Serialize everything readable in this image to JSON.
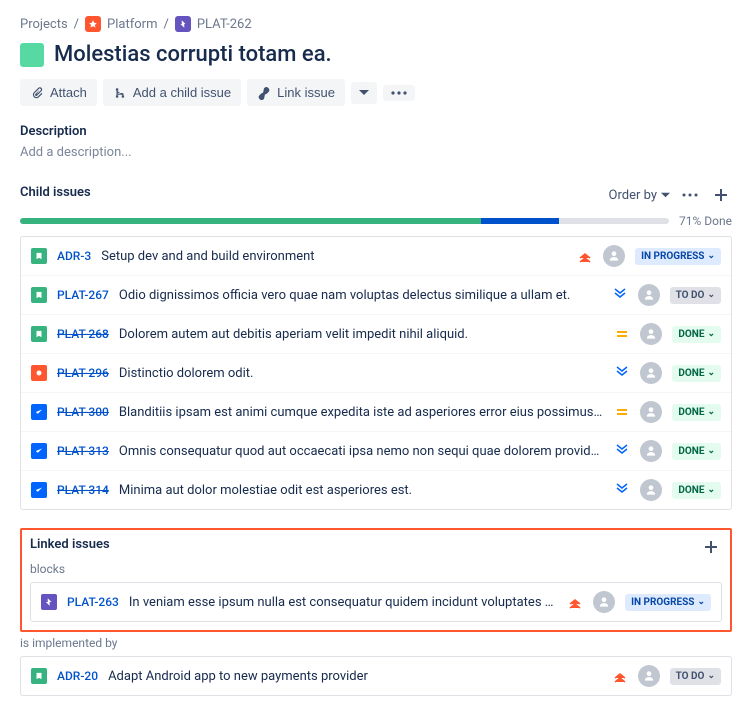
{
  "breadcrumb": {
    "root": "Projects",
    "project": "Platform",
    "issue": "PLAT-262"
  },
  "title": "Molestias corrupti totam ea.",
  "actions": {
    "attach": "Attach",
    "add_child": "Add a child issue",
    "link": "Link issue"
  },
  "description": {
    "label": "Description",
    "placeholder": "Add a description..."
  },
  "child_issues": {
    "label": "Child issues",
    "order_by": "Order by",
    "progress_done_pct": 71,
    "progress_inprogress_pct": 12,
    "progress_label": "71% Done",
    "items": [
      {
        "type": "story",
        "key": "ADR-3",
        "done": false,
        "summary": "Setup dev and and build environment",
        "priority": "highest",
        "status": "IN PROGRESS",
        "status_class": "inprogress"
      },
      {
        "type": "story",
        "key": "PLAT-267",
        "done": false,
        "summary": "Odio dignissimos officia vero quae nam voluptas delectus similique a ullam et.",
        "priority": "lowest",
        "status": "TO DO",
        "status_class": "todo"
      },
      {
        "type": "story",
        "key": "PLAT-268",
        "done": true,
        "summary": "Dolorem autem aut debitis aperiam velit impedit nihil aliquid.",
        "priority": "medium",
        "status": "DONE",
        "status_class": "done"
      },
      {
        "type": "bug",
        "key": "PLAT-296",
        "done": true,
        "summary": "Distinctio dolorem odit.",
        "priority": "lowest",
        "status": "DONE",
        "status_class": "done"
      },
      {
        "type": "task",
        "key": "PLAT-300",
        "done": true,
        "summary": "Blanditiis ipsam est animi cumque expedita iste ad asperiores error eius possimus quasi porro mollitia c...",
        "priority": "medium",
        "status": "DONE",
        "status_class": "done"
      },
      {
        "type": "task",
        "key": "PLAT-313",
        "done": true,
        "summary": "Omnis consequatur quod aut occaecati ipsa nemo non sequi quae dolorem provident omnis facilis volup...",
        "priority": "lowest",
        "status": "DONE",
        "status_class": "done"
      },
      {
        "type": "task",
        "key": "PLAT-314",
        "done": true,
        "summary": "Minima aut dolor molestiae odit est asperiores est.",
        "priority": "lowest",
        "status": "DONE",
        "status_class": "done"
      }
    ]
  },
  "linked_issues": {
    "label": "Linked issues",
    "groups": [
      {
        "label": "blocks",
        "highlighted": true,
        "items": [
          {
            "type": "epic",
            "key": "PLAT-263",
            "done": false,
            "summary": "In veniam esse ipsum nulla est consequatur quidem incidunt voluptates quisquam veritatis aut.",
            "priority": "highest",
            "status": "IN PROGRESS",
            "status_class": "inprogress"
          }
        ]
      },
      {
        "label": "is implemented by",
        "highlighted": false,
        "items": [
          {
            "type": "story",
            "key": "ADR-20",
            "done": false,
            "summary": "Adapt Android app to new payments provider",
            "priority": "highest",
            "status": "TO DO",
            "status_class": "todo"
          }
        ]
      }
    ]
  }
}
